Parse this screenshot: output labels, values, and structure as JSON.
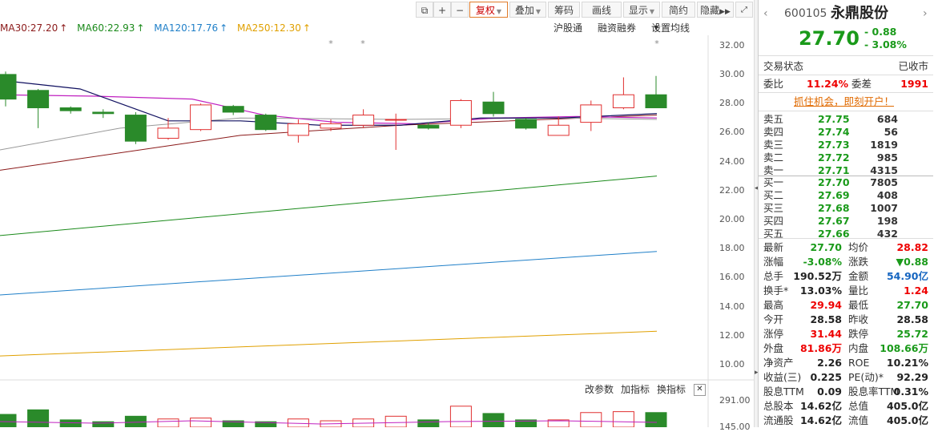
{
  "toolbar": {
    "buttons": [
      "复权",
      "叠加",
      "筹码",
      "画线",
      "显示",
      "简约",
      "隐藏"
    ]
  },
  "ma": [
    {
      "label": "MA30:27.20",
      "arrow": "↑",
      "color": "#8b1a1a"
    },
    {
      "label": "MA60:22.93",
      "arrow": "↑",
      "color": "#1a8a1a"
    },
    {
      "label": "MA120:17.76",
      "arrow": "↑",
      "color": "#1f7fc8"
    },
    {
      "label": "MA250:12.30",
      "arrow": "↑",
      "color": "#e0a000"
    }
  ],
  "links": {
    "hgt": "沪股通",
    "rzrq": "融资融券",
    "setma": "设置均线"
  },
  "yaxis": [
    "32.00",
    "30.00",
    "28.00",
    "26.00",
    "24.00",
    "22.00",
    "20.00",
    "18.00",
    "16.00",
    "14.00",
    "12.00",
    "10.00"
  ],
  "vol": {
    "params": "改参数",
    "add": "加指标",
    "swap": "换指标",
    "close": "✕",
    "tick1": "291.00",
    "tick2": "145.00"
  },
  "stock": {
    "code": "600105",
    "name": "永鼎股份",
    "price": "27.70",
    "change": "- 0.88",
    "pct": "- 3.08%"
  },
  "status": {
    "label": "交易状态",
    "value": "已收市"
  },
  "weibi": {
    "label": "委比",
    "value": "11.24%",
    "diff_label": "委差",
    "diff": "1991"
  },
  "ad": "抓住机会，即刻开户！",
  "asks": [
    {
      "label": "卖五",
      "price": "27.75",
      "vol": "684"
    },
    {
      "label": "卖四",
      "price": "27.74",
      "vol": "56"
    },
    {
      "label": "卖三",
      "price": "27.73",
      "vol": "1819"
    },
    {
      "label": "卖二",
      "price": "27.72",
      "vol": "985"
    },
    {
      "label": "卖一",
      "price": "27.71",
      "vol": "4315"
    }
  ],
  "bids": [
    {
      "label": "买一",
      "price": "27.70",
      "vol": "7805"
    },
    {
      "label": "买二",
      "price": "27.69",
      "vol": "408"
    },
    {
      "label": "买三",
      "price": "27.68",
      "vol": "1007"
    },
    {
      "label": "买四",
      "price": "27.67",
      "vol": "198"
    },
    {
      "label": "买五",
      "price": "27.66",
      "vol": "432"
    }
  ],
  "stats": [
    {
      "l1": "最新",
      "v1": "27.70",
      "c1": "green",
      "l2": "均价",
      "v2": "28.82",
      "c2": "red"
    },
    {
      "l1": "涨幅",
      "v1": "-3.08%",
      "c1": "green",
      "l2": "涨跌",
      "v2": "▼0.88",
      "c2": "green"
    },
    {
      "l1": "总手",
      "v1": "190.52万",
      "c1": "",
      "l2": "金额",
      "v2": "54.90亿",
      "c2": "blue"
    },
    {
      "l1": "换手*",
      "v1": "13.03%",
      "c1": "",
      "l2": "量比",
      "v2": "1.24",
      "c2": "red"
    },
    {
      "l1": "最高",
      "v1": "29.94",
      "c1": "red",
      "l2": "最低",
      "v2": "27.70",
      "c2": "green"
    },
    {
      "l1": "今开",
      "v1": "28.58",
      "c1": "",
      "l2": "昨收",
      "v2": "28.58",
      "c2": ""
    },
    {
      "l1": "涨停",
      "v1": "31.44",
      "c1": "red",
      "l2": "跌停",
      "v2": "25.72",
      "c2": "green"
    },
    {
      "l1": "外盘",
      "v1": "81.86万",
      "c1": "red",
      "l2": "内盘",
      "v2": "108.66万",
      "c2": "green"
    },
    {
      "l1": "净资产",
      "v1": "2.26",
      "c1": "",
      "l2": "ROE",
      "v2": "10.21%",
      "c2": ""
    },
    {
      "l1": "收益(三)",
      "v1": "0.225",
      "c1": "",
      "l2": "PE(动)*",
      "v2": "92.29",
      "c2": ""
    },
    {
      "l1": "股息TTM",
      "v1": "0.09",
      "c1": "",
      "l2": "股息率TTM",
      "v2": "0.31%",
      "c2": ""
    },
    {
      "l1": "总股本",
      "v1": "14.62亿",
      "c1": "",
      "l2": "总值",
      "v2": "405.0亿",
      "c2": ""
    },
    {
      "l1": "流通股",
      "v1": "14.62亿",
      "c1": "",
      "l2": "流值",
      "v2": "405.0亿",
      "c2": ""
    }
  ],
  "chart_data": {
    "type": "candlestick",
    "ylim": [
      9.5,
      32.7
    ],
    "candles": [
      {
        "o": 30.0,
        "c": 28.3,
        "h": 30.2,
        "l": 27.8
      },
      {
        "o": 28.9,
        "c": 27.7,
        "h": 29.0,
        "l": 26.3
      },
      {
        "o": 27.7,
        "c": 27.5,
        "h": 27.8,
        "l": 27.3
      },
      {
        "o": 27.4,
        "c": 27.3,
        "h": 27.6,
        "l": 27.0
      },
      {
        "o": 27.2,
        "c": 25.4,
        "h": 27.4,
        "l": 25.2
      },
      {
        "o": 25.6,
        "c": 26.3,
        "h": 27.0,
        "l": 25.5
      },
      {
        "o": 26.2,
        "c": 27.9,
        "h": 28.0,
        "l": 26.1
      },
      {
        "o": 27.8,
        "c": 27.4,
        "h": 27.9,
        "l": 27.2
      },
      {
        "o": 27.2,
        "c": 26.2,
        "h": 27.3,
        "l": 26.1
      },
      {
        "o": 25.8,
        "c": 26.6,
        "h": 26.9,
        "l": 25.3
      },
      {
        "o": 26.3,
        "c": 26.6,
        "h": 26.9,
        "l": 26.1
      },
      {
        "o": 26.5,
        "c": 27.2,
        "h": 27.6,
        "l": 26.3
      },
      {
        "o": 26.9,
        "c": 26.9,
        "h": 27.3,
        "l": 24.8
      },
      {
        "o": 26.5,
        "c": 26.3,
        "h": 26.7,
        "l": 26.2
      },
      {
        "o": 26.5,
        "c": 28.2,
        "h": 28.3,
        "l": 26.3
      },
      {
        "o": 28.1,
        "c": 27.3,
        "h": 28.8,
        "l": 27.1
      },
      {
        "o": 26.9,
        "c": 26.3,
        "h": 27.0,
        "l": 26.2
      },
      {
        "o": 25.8,
        "c": 26.5,
        "h": 27.1,
        "l": 25.8
      },
      {
        "o": 26.7,
        "c": 27.9,
        "h": 28.2,
        "l": 26.1
      },
      {
        "o": 27.7,
        "c": 28.6,
        "h": 29.8,
        "l": 27.6
      },
      {
        "o": 28.6,
        "c": 27.7,
        "h": 29.9,
        "l": 27.7
      }
    ],
    "ma_lines": [
      {
        "name": "MA250",
        "color": "#e0a000",
        "start": 10.6,
        "end": 12.3
      },
      {
        "name": "MA120",
        "color": "#1f7fc8",
        "start": 14.8,
        "end": 17.8
      },
      {
        "name": "MA60",
        "color": "#1a8a1a",
        "start": 18.9,
        "end": 23.0
      }
    ],
    "volume": [
      0.7,
      0.95,
      0.4,
      0.3,
      0.6,
      0.45,
      0.5,
      0.35,
      0.3,
      0.45,
      0.35,
      0.45,
      0.6,
      0.4,
      1.15,
      0.75,
      0.4,
      0.4,
      0.8,
      0.85,
      0.8
    ]
  }
}
